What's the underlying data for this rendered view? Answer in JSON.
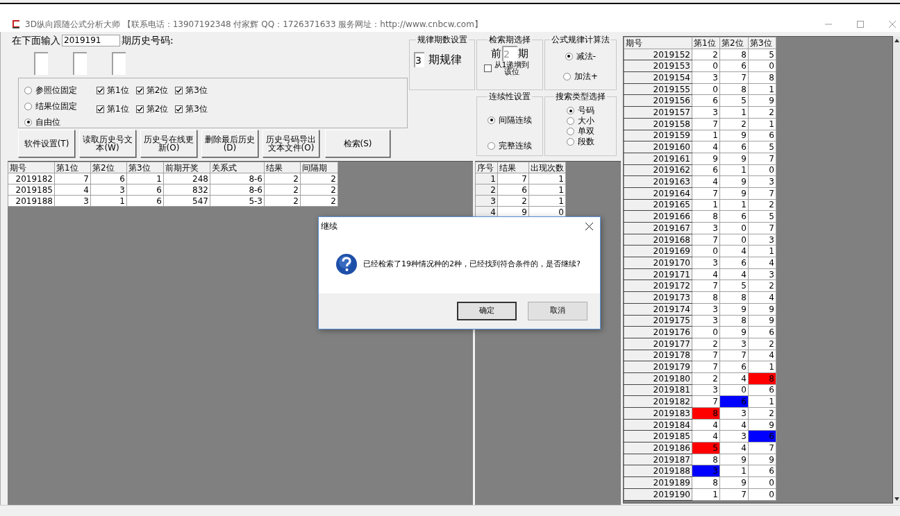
{
  "window": {
    "title": "3D纵向跟随公式分析大师 【联系电话：13907192348 付家辉 QQ：1726371633 服务网址：http://www.cnbcw.com】"
  },
  "query": {
    "prefix": "在下面输入",
    "value": "2019191",
    "suffix": "期历史号码:"
  },
  "digit_fields": [
    {
      "kind": "field"
    },
    {
      "kind": "field"
    },
    {
      "kind": "field"
    }
  ],
  "position_mode": {
    "options": [
      {
        "label": "参照位固定",
        "selected": false
      },
      {
        "label": "结果位固定",
        "selected": false
      },
      {
        "label": "自由位",
        "selected": true
      }
    ],
    "checkbox_rows": [
      [
        {
          "label": "第1位",
          "checked": true
        },
        {
          "label": "第2位",
          "checked": true
        },
        {
          "label": "第3位",
          "checked": true
        }
      ],
      [
        {
          "label": "第1位",
          "checked": true
        },
        {
          "label": "第2位",
          "checked": true
        },
        {
          "label": "第3位",
          "checked": true
        }
      ]
    ]
  },
  "buttons": [
    "软件设置(T)",
    "读取历史号文本(W)",
    "历史号在线更新(O)",
    "删除最后历史(D)",
    "历史号码导出文本文件(O)",
    "检索(S)"
  ],
  "period_rule": {
    "title": "规律期数设置",
    "value": "3",
    "label": "期规律"
  },
  "search_period": {
    "title": "检索期选择",
    "prefix": "前",
    "placeholder": "2",
    "suffix": "期",
    "checkbox": {
      "label": "从1递增到该位",
      "checked": false
    }
  },
  "formula": {
    "title": "公式规律计算法",
    "options": [
      {
        "label": "减法-",
        "selected": true
      },
      {
        "label": "加法+",
        "selected": false
      }
    ]
  },
  "continuity": {
    "title": "连续性设置",
    "options": [
      {
        "label": "间隔连续",
        "selected": true
      },
      {
        "label": "完整连续",
        "selected": false
      }
    ]
  },
  "search_type": {
    "title": "搜索类型选择",
    "options": [
      {
        "label": "号码",
        "selected": true
      },
      {
        "label": "大小",
        "selected": false
      },
      {
        "label": "单双",
        "selected": false
      },
      {
        "label": "段数",
        "selected": false
      }
    ]
  },
  "result_table": {
    "columns": [
      "期号",
      "第1位",
      "第2位",
      "第3位",
      "前期开奖",
      "关系式",
      "结果",
      "间隔期"
    ],
    "rows": [
      [
        "2019182",
        "7",
        "6",
        "1",
        "248",
        "8-6",
        "2",
        "2"
      ],
      [
        "2019185",
        "4",
        "3",
        "6",
        "832",
        "8-6",
        "2",
        "2"
      ],
      [
        "2019188",
        "3",
        "1",
        "6",
        "547",
        "5-3",
        "2",
        "2"
      ]
    ]
  },
  "count_table": {
    "columns": [
      "序号",
      "结果",
      "出现次数"
    ],
    "rows": [
      [
        "1",
        "7",
        "1"
      ],
      [
        "2",
        "6",
        "1"
      ],
      [
        "3",
        "2",
        "1"
      ],
      [
        "4",
        "9",
        "0"
      ]
    ]
  },
  "history_table": {
    "columns": [
      "期号",
      "第1位",
      "第2位",
      "第3位"
    ],
    "rows": [
      [
        {
          "text": "2019152"
        },
        {
          "text": "2"
        },
        {
          "text": "8"
        },
        {
          "text": "5"
        }
      ],
      [
        {
          "text": "2019153"
        },
        {
          "text": "0"
        },
        {
          "text": "6"
        },
        {
          "text": "0"
        }
      ],
      [
        {
          "text": "2019154"
        },
        {
          "text": "3"
        },
        {
          "text": "7"
        },
        {
          "text": "8"
        }
      ],
      [
        {
          "text": "2019155"
        },
        {
          "text": "0"
        },
        {
          "text": "8"
        },
        {
          "text": "1"
        }
      ],
      [
        {
          "text": "2019156"
        },
        {
          "text": "6"
        },
        {
          "text": "5"
        },
        {
          "text": "9"
        }
      ],
      [
        {
          "text": "2019157"
        },
        {
          "text": "3"
        },
        {
          "text": "1"
        },
        {
          "text": "2"
        }
      ],
      [
        {
          "text": "2019158"
        },
        {
          "text": "7"
        },
        {
          "text": "2"
        },
        {
          "text": "1"
        }
      ],
      [
        {
          "text": "2019159"
        },
        {
          "text": "1"
        },
        {
          "text": "9"
        },
        {
          "text": "6"
        }
      ],
      [
        {
          "text": "2019160"
        },
        {
          "text": "4"
        },
        {
          "text": "6"
        },
        {
          "text": "5"
        }
      ],
      [
        {
          "text": "2019161"
        },
        {
          "text": "9"
        },
        {
          "text": "9"
        },
        {
          "text": "7"
        }
      ],
      [
        {
          "text": "2019162"
        },
        {
          "text": "6"
        },
        {
          "text": "1"
        },
        {
          "text": "0"
        }
      ],
      [
        {
          "text": "2019163"
        },
        {
          "text": "4"
        },
        {
          "text": "9"
        },
        {
          "text": "3"
        }
      ],
      [
        {
          "text": "2019164"
        },
        {
          "text": "7"
        },
        {
          "text": "9"
        },
        {
          "text": "7"
        }
      ],
      [
        {
          "text": "2019165"
        },
        {
          "text": "1"
        },
        {
          "text": "1"
        },
        {
          "text": "2"
        }
      ],
      [
        {
          "text": "2019166"
        },
        {
          "text": "8"
        },
        {
          "text": "6"
        },
        {
          "text": "5"
        }
      ],
      [
        {
          "text": "2019167"
        },
        {
          "text": "3"
        },
        {
          "text": "0"
        },
        {
          "text": "7"
        }
      ],
      [
        {
          "text": "2019168"
        },
        {
          "text": "7"
        },
        {
          "text": "0"
        },
        {
          "text": "3"
        }
      ],
      [
        {
          "text": "2019169"
        },
        {
          "text": "0"
        },
        {
          "text": "4"
        },
        {
          "text": "1"
        }
      ],
      [
        {
          "text": "2019170"
        },
        {
          "text": "3"
        },
        {
          "text": "6"
        },
        {
          "text": "4"
        }
      ],
      [
        {
          "text": "2019171"
        },
        {
          "text": "4"
        },
        {
          "text": "4"
        },
        {
          "text": "3"
        }
      ],
      [
        {
          "text": "2019172"
        },
        {
          "text": "7"
        },
        {
          "text": "5"
        },
        {
          "text": "2"
        }
      ],
      [
        {
          "text": "2019173"
        },
        {
          "text": "8"
        },
        {
          "text": "8"
        },
        {
          "text": "4"
        }
      ],
      [
        {
          "text": "2019174"
        },
        {
          "text": "3"
        },
        {
          "text": "9"
        },
        {
          "text": "9"
        }
      ],
      [
        {
          "text": "2019175"
        },
        {
          "text": "3"
        },
        {
          "text": "8"
        },
        {
          "text": "9"
        }
      ],
      [
        {
          "text": "2019176"
        },
        {
          "text": "0"
        },
        {
          "text": "9"
        },
        {
          "text": "6"
        }
      ],
      [
        {
          "text": "2019177"
        },
        {
          "text": "2"
        },
        {
          "text": "3"
        },
        {
          "text": "2"
        }
      ],
      [
        {
          "text": "2019178"
        },
        {
          "text": "7"
        },
        {
          "text": "7"
        },
        {
          "text": "4"
        }
      ],
      [
        {
          "text": "2019179"
        },
        {
          "text": "7"
        },
        {
          "text": "6"
        },
        {
          "text": "1"
        }
      ],
      [
        {
          "text": "2019180"
        },
        {
          "text": "2"
        },
        {
          "text": "4"
        },
        {
          "text": "8",
          "color": "#ff0000"
        }
      ],
      [
        {
          "text": "2019181"
        },
        {
          "text": "3"
        },
        {
          "text": "0"
        },
        {
          "text": "6"
        }
      ],
      [
        {
          "text": "2019182"
        },
        {
          "text": "7"
        },
        {
          "text": "6",
          "color": "#0000ff"
        },
        {
          "text": "1"
        }
      ],
      [
        {
          "text": "2019183"
        },
        {
          "text": "8",
          "color": "#ff0000"
        },
        {
          "text": "3"
        },
        {
          "text": "2"
        }
      ],
      [
        {
          "text": "2019184"
        },
        {
          "text": "4"
        },
        {
          "text": "4"
        },
        {
          "text": "9"
        }
      ],
      [
        {
          "text": "2019185"
        },
        {
          "text": "4"
        },
        {
          "text": "3"
        },
        {
          "text": "6",
          "color": "#0000ff"
        }
      ],
      [
        {
          "text": "2019186"
        },
        {
          "text": "5",
          "color": "#ff0000"
        },
        {
          "text": "4"
        },
        {
          "text": "7"
        }
      ],
      [
        {
          "text": "2019187"
        },
        {
          "text": "8"
        },
        {
          "text": "9"
        },
        {
          "text": "9"
        }
      ],
      [
        {
          "text": "2019188"
        },
        {
          "text": "3",
          "color": "#0000ff"
        },
        {
          "text": "1"
        },
        {
          "text": "6"
        }
      ],
      [
        {
          "text": "2019189"
        },
        {
          "text": "8"
        },
        {
          "text": "9"
        },
        {
          "text": "0"
        }
      ],
      [
        {
          "text": "2019190"
        },
        {
          "text": "1"
        },
        {
          "text": "7"
        },
        {
          "text": "0"
        }
      ]
    ]
  },
  "dialog": {
    "title": "继续",
    "message": "已经检索了19种情况种的2种，已经找到符合条件的，是否继续?",
    "buttons": [
      {
        "label": "确定",
        "default": true
      },
      {
        "label": "取消",
        "default": false
      }
    ]
  }
}
